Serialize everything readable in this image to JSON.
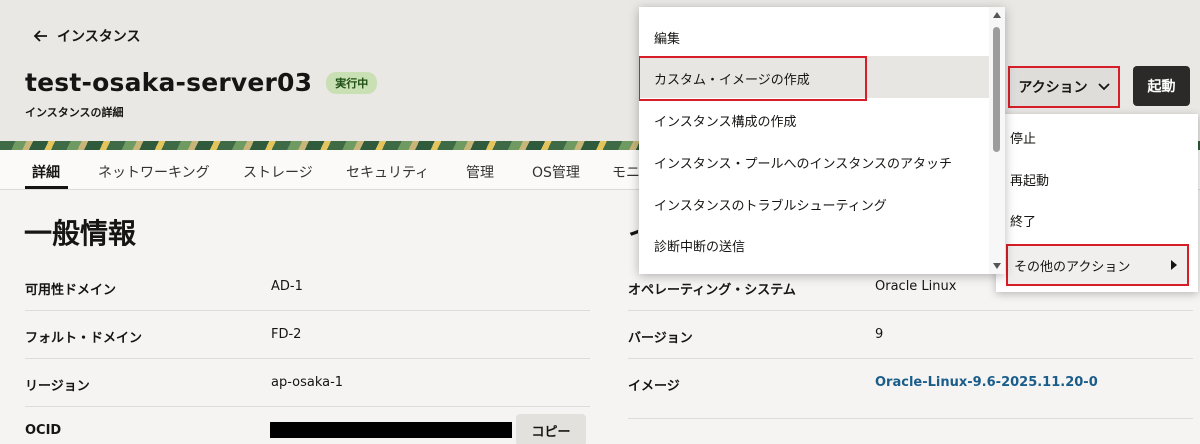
{
  "header": {
    "back_label": "インスタンス",
    "title": "test-osaka-server03",
    "status": "実行中",
    "subtitle": "インスタンスの詳細",
    "actions_label": "アクション",
    "start_label": "起動"
  },
  "tabs": [
    {
      "label": "詳細"
    },
    {
      "label": "ネットワーキング"
    },
    {
      "label": "ストレージ"
    },
    {
      "label": "セキュリティ"
    },
    {
      "label": "管理"
    },
    {
      "label": "OS管理"
    },
    {
      "label": "モニ"
    }
  ],
  "general": {
    "title": "一般情報",
    "right_title": "イ",
    "rows": [
      {
        "label": "可用性ドメイン",
        "value": "AD-1"
      },
      {
        "label": "フォルト・ドメイン",
        "value": "FD-2"
      },
      {
        "label": "リージョン",
        "value": "ap-osaka-1"
      },
      {
        "label": "OCID",
        "copy_label": "コピー"
      }
    ]
  },
  "image_info": {
    "rows": [
      {
        "label": "オペレーティング・システム",
        "value": "Oracle Linux"
      },
      {
        "label": "バージョン",
        "value": "9"
      },
      {
        "label": "イメージ",
        "value": "Oracle-Linux-9.6-2025.11.20-0"
      }
    ]
  },
  "actions_menu": {
    "items": [
      {
        "label": "停止"
      },
      {
        "label": "再起動"
      },
      {
        "label": "終了"
      }
    ],
    "more_label": "その他のアクション"
  },
  "sub_menu": {
    "items": [
      {
        "label": "編集"
      },
      {
        "label": "カスタム・イメージの作成"
      },
      {
        "label": "インスタンス構成の作成"
      },
      {
        "label": "インスタンス・プールへのインスタンスのアタッチ"
      },
      {
        "label": "インスタンスのトラブルシューティング"
      },
      {
        "label": "診断中断の送信"
      }
    ]
  },
  "colors": {
    "highlight_border": "#d71e28",
    "status_bg": "#c9dfb4",
    "link": "#1a5d8a"
  }
}
